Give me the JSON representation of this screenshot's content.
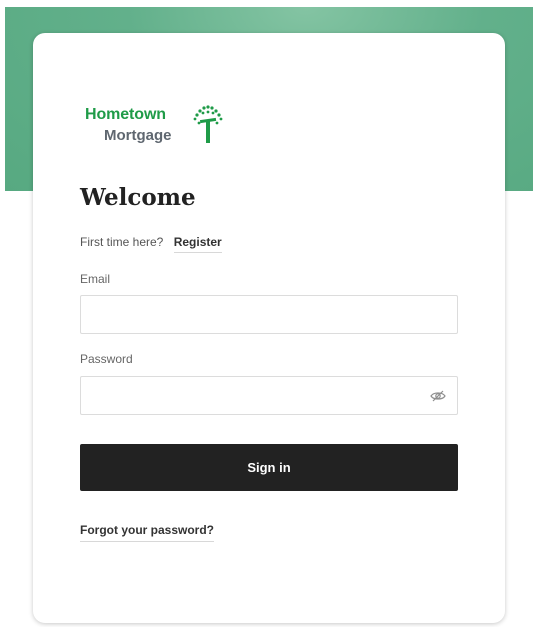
{
  "brand": {
    "name_line1": "Hometown",
    "name_line2": "Mortgage",
    "primary_color": "#1f9b48",
    "band_color": "#5aab84"
  },
  "login": {
    "title": "Welcome",
    "first_time_text": "First time here?",
    "register_label": "Register",
    "email_label": "Email",
    "email_value": "",
    "password_label": "Password",
    "password_value": "",
    "toggle_icon": "eye-off-icon",
    "signin_label": "Sign in",
    "forgot_label": "Forgot your password?"
  }
}
